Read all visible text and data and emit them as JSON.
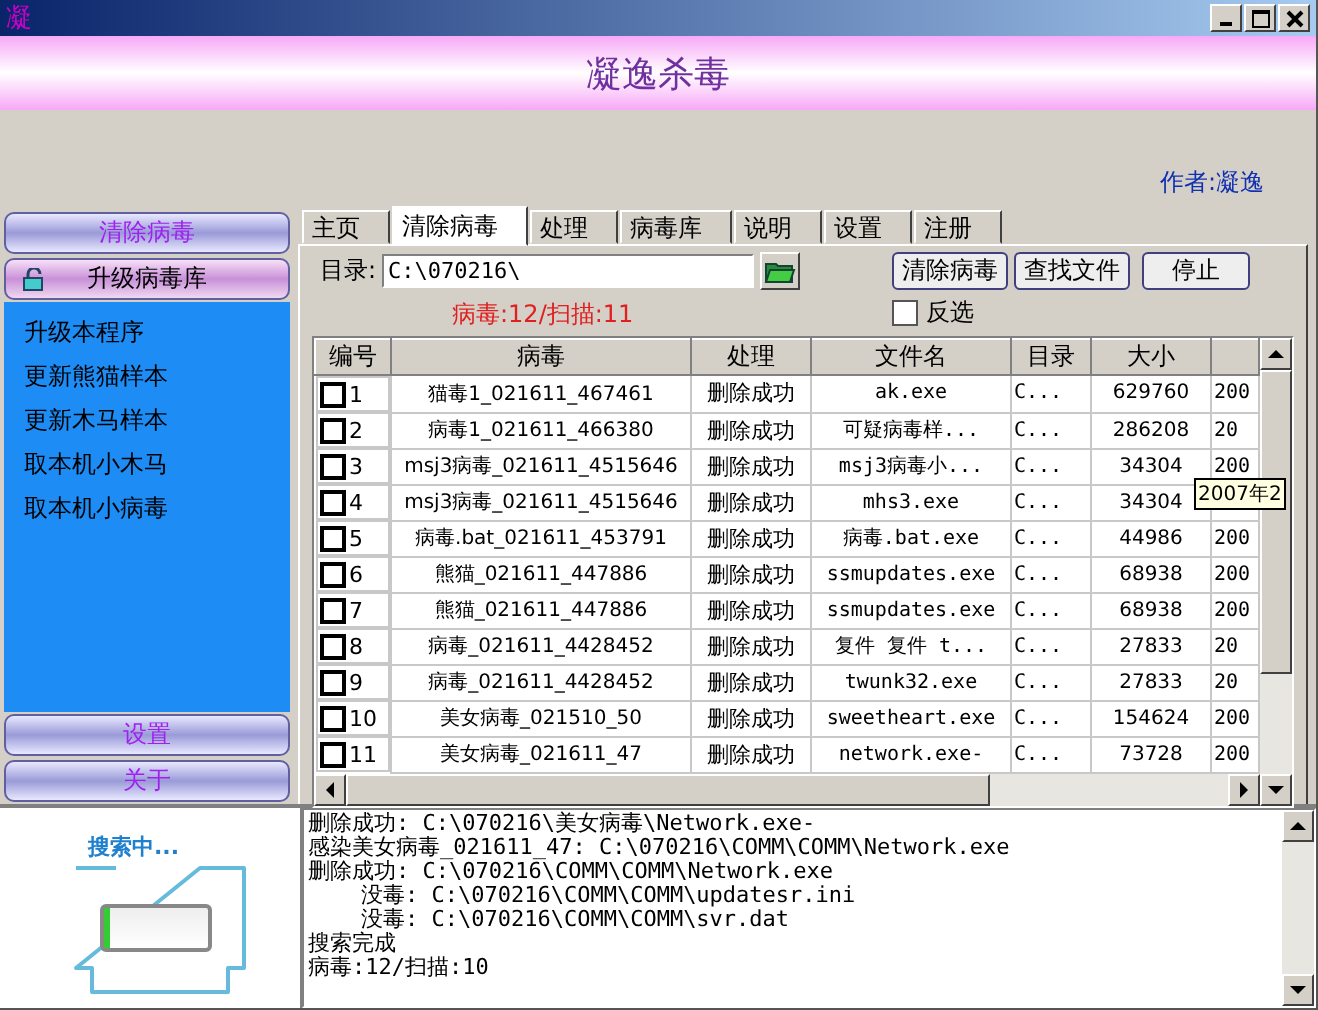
{
  "window": {
    "title": "凝"
  },
  "banner": {
    "title": "凝逸杀毒"
  },
  "author": "作者:凝逸",
  "sidebar": {
    "sections": [
      {
        "label": "清除病毒",
        "selected": false
      },
      {
        "label": "升级病毒库",
        "selected": true,
        "items": [
          "升级本程序",
          "更新熊猫样本",
          "更新木马样本",
          "取本机小木马",
          "取本机小病毒"
        ]
      },
      {
        "label": "设置",
        "selected": false
      },
      {
        "label": "关于",
        "selected": false
      }
    ]
  },
  "tabs": [
    {
      "label": "主页",
      "selected": false
    },
    {
      "label": "清除病毒",
      "selected": true
    },
    {
      "label": "处理",
      "selected": false
    },
    {
      "label": "病毒库",
      "selected": false
    },
    {
      "label": "说明",
      "selected": false
    },
    {
      "label": "设置",
      "selected": false
    },
    {
      "label": "注册",
      "selected": false
    }
  ],
  "directory": {
    "label": "目录:",
    "value": "C:\\070216\\"
  },
  "status": "病毒:12/扫描:11",
  "buttons": [
    "清除病毒",
    "查找文件",
    "停止"
  ],
  "invert": {
    "label": "反选",
    "checked": false
  },
  "table": {
    "columns": [
      "编号",
      "病毒",
      "处理",
      "文件名",
      "目录",
      "大小"
    ],
    "rows": [
      {
        "checked": false,
        "cells": [
          "1",
          "猫毒1_021611_467461",
          "删除成功",
          "ak.exe",
          "C...",
          "629760"
        ],
        "date": "200"
      },
      {
        "checked": false,
        "cells": [
          "2",
          "病毒1_021611_466380",
          "删除成功",
          "可疑病毒样...",
          "C...",
          "286208"
        ],
        "date": "20"
      },
      {
        "checked": false,
        "cells": [
          "3",
          "msj3病毒_021611_4515646",
          "删除成功",
          "msj3病毒小...",
          "C...",
          "34304"
        ],
        "date": "200"
      },
      {
        "checked": false,
        "cells": [
          "4",
          "msj3病毒_021611_4515646",
          "删除成功",
          "mhs3.exe",
          "C...",
          "34304"
        ]
      },
      {
        "checked": false,
        "cells": [
          "5",
          "病毒.bat_021611_453791",
          "删除成功",
          "病毒.bat.exe",
          "C...",
          "44986"
        ],
        "date": "200"
      },
      {
        "checked": false,
        "cells": [
          "6",
          "熊猫_021611_447886",
          "删除成功",
          "ssmupdates.exe",
          "C...",
          "68938"
        ],
        "date": "200"
      },
      {
        "checked": false,
        "cells": [
          "7",
          "熊猫_021611_447886",
          "删除成功",
          "ssmupdates.exe",
          "C...",
          "68938"
        ],
        "date": "200"
      },
      {
        "checked": false,
        "cells": [
          "8",
          "病毒_021611_4428452",
          "删除成功",
          "复件 复件 t...",
          "C...",
          "27833"
        ],
        "date": "20"
      },
      {
        "checked": false,
        "cells": [
          "9",
          "病毒_021611_4428452",
          "删除成功",
          "twunk32.exe",
          "C...",
          "27833"
        ],
        "date": "20"
      },
      {
        "checked": false,
        "cells": [
          "10",
          "美女病毒_021510_50",
          "删除成功",
          "sweetheart.exe",
          "C...",
          "154624"
        ],
        "date": "200"
      },
      {
        "checked": false,
        "cells": [
          "11",
          "美女病毒_021611_47",
          "删除成功",
          "network.exe-",
          "C...",
          "73728"
        ],
        "date": "200"
      }
    ],
    "tooltip": "2007年2"
  },
  "progress": {
    "label": "搜索中...",
    "level": 0.06
  },
  "log": [
    "删除成功: C:\\070216\\美女病毒\\Network.exe-",
    "感染美女病毒_021611_47: C:\\070216\\COMM\\COMM\\Network.exe",
    "删除成功: C:\\070216\\COMM\\COMM\\Network.exe",
    "    没毒: C:\\070216\\COMM\\COMM\\updatesr.ini",
    "    没毒: C:\\070216\\COMM\\COMM\\svr.dat",
    "搜索完成",
    "病毒:12/扫描:10"
  ]
}
